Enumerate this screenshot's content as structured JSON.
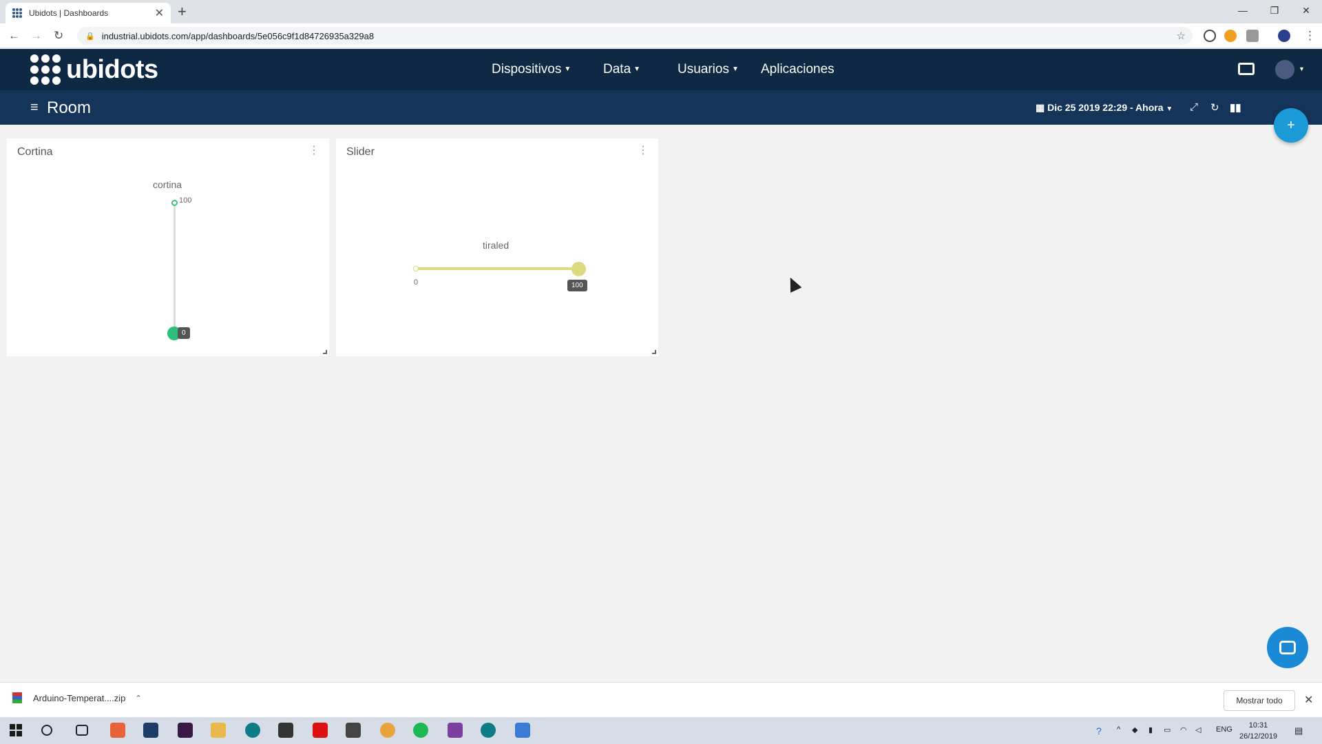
{
  "browser": {
    "tab_title": "Ubidots | Dashboards",
    "url": "industrial.ubidots.com/app/dashboards/5e056c9f1d84726935a329a8"
  },
  "header": {
    "logo_text": "ubidots",
    "nav": [
      {
        "label": "Dispositivos"
      },
      {
        "label": "Data"
      },
      {
        "label": "Usuarios"
      },
      {
        "label": "Aplicaciones"
      }
    ]
  },
  "subheader": {
    "title": "Room",
    "date_range": "Dic 25 2019 22:29 - Ahora"
  },
  "widgets": {
    "cortina": {
      "title": "Cortina",
      "variable": "cortina",
      "max_label": "100",
      "value_label": "0",
      "value": 0,
      "range": [
        0,
        100
      ],
      "accent": "#2dbf7a"
    },
    "slider": {
      "title": "Slider",
      "variable": "tiraled",
      "min_label": "0",
      "value_label": "100",
      "value": 100,
      "range": [
        0,
        100
      ],
      "accent": "#ddd97e"
    }
  },
  "downloads": {
    "file": "Arduino-Temperat....zip",
    "show_all": "Mostrar todo"
  },
  "taskbar": {
    "lang": "ENG",
    "time": "10:31",
    "date": "26/12/2019"
  },
  "colors": {
    "header_bg": "#0f2844",
    "subheader_bg": "#15345a",
    "fab": "#1a9ad6"
  }
}
